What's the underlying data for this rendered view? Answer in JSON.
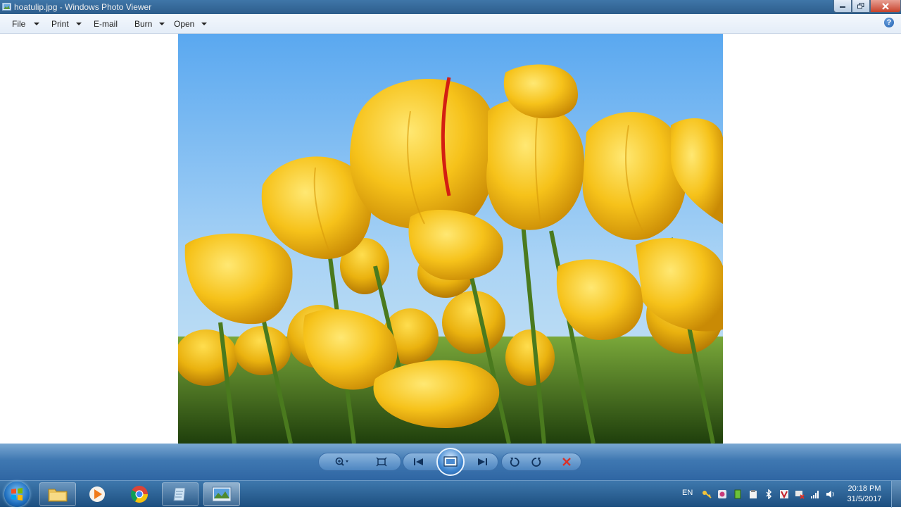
{
  "window": {
    "title": "hoatulip.jpg - Windows Photo Viewer",
    "icon": "photo-viewer-icon"
  },
  "menu": {
    "items": [
      {
        "label": "File",
        "has_dropdown": true
      },
      {
        "label": "Print",
        "has_dropdown": true
      },
      {
        "label": "E-mail",
        "has_dropdown": false
      },
      {
        "label": "Burn",
        "has_dropdown": true
      },
      {
        "label": "Open",
        "has_dropdown": true
      }
    ],
    "help_label": "?"
  },
  "image": {
    "subject": "yellow tulips against blue sky"
  },
  "controls": {
    "buttons": [
      "zoom-icon",
      "fit-window-icon",
      "previous-icon",
      "slideshow-icon",
      "next-icon",
      "rotate-counterclockwise-icon",
      "rotate-clockwise-icon",
      "delete-icon"
    ]
  },
  "taskbar": {
    "pinned": [
      "windows-explorer-icon",
      "media-player-icon",
      "chrome-icon",
      "notepad-icon",
      "photo-viewer-icon"
    ],
    "language": "EN",
    "time": "20:18 PM",
    "date": "31/5/2017"
  },
  "colors": {
    "sky_top": "#63aef2",
    "sky_bottom": "#bfe0f5",
    "tulip": "#f5c518",
    "stem": "#4a7a1e",
    "delete": "#d9322a"
  }
}
